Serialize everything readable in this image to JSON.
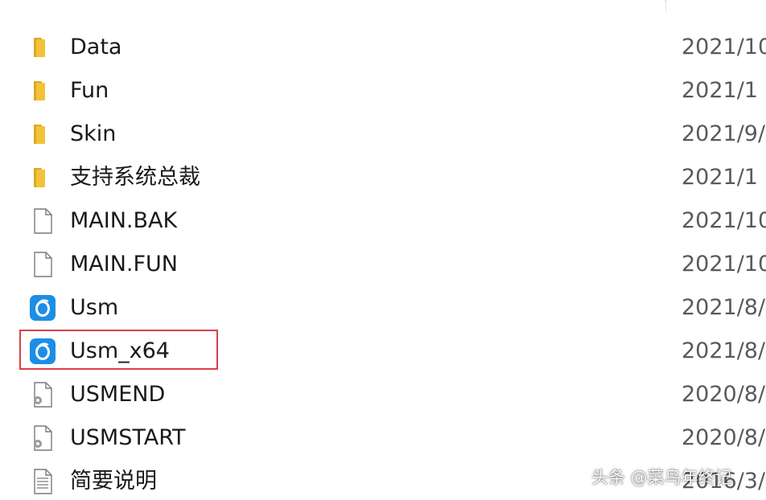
{
  "files": [
    {
      "name": "Data",
      "date": "2021/10",
      "icon": "folder-icon"
    },
    {
      "name": "Fun",
      "date": "2021/1",
      "icon": "folder-icon"
    },
    {
      "name": "Skin",
      "date": "2021/9/",
      "icon": "folder-icon"
    },
    {
      "name": "支持系统总裁",
      "date": "2021/1",
      "icon": "folder-icon"
    },
    {
      "name": "MAIN.BAK",
      "date": "2021/10",
      "icon": "blank-file-icon"
    },
    {
      "name": "MAIN.FUN",
      "date": "2021/10",
      "icon": "blank-file-icon"
    },
    {
      "name": "Usm",
      "date": "2021/8/",
      "icon": "app-icon"
    },
    {
      "name": "Usm_x64",
      "date": "2021/8/",
      "icon": "app-icon"
    },
    {
      "name": "USMEND",
      "date": "2020/8/",
      "icon": "script-file-icon"
    },
    {
      "name": "USMSTART",
      "date": "2020/8/",
      "icon": "script-file-icon"
    },
    {
      "name": "简要说明",
      "date": "2016/3/",
      "icon": "text-file-icon"
    }
  ],
  "highlighted_file": "Usm_x64",
  "watermark": "头条 @菜鸟年终记",
  "colors": {
    "folder": "#f2c33a",
    "folder_dark": "#dca821",
    "app_icon": "#1c8ee6",
    "highlight": "#d94048"
  }
}
